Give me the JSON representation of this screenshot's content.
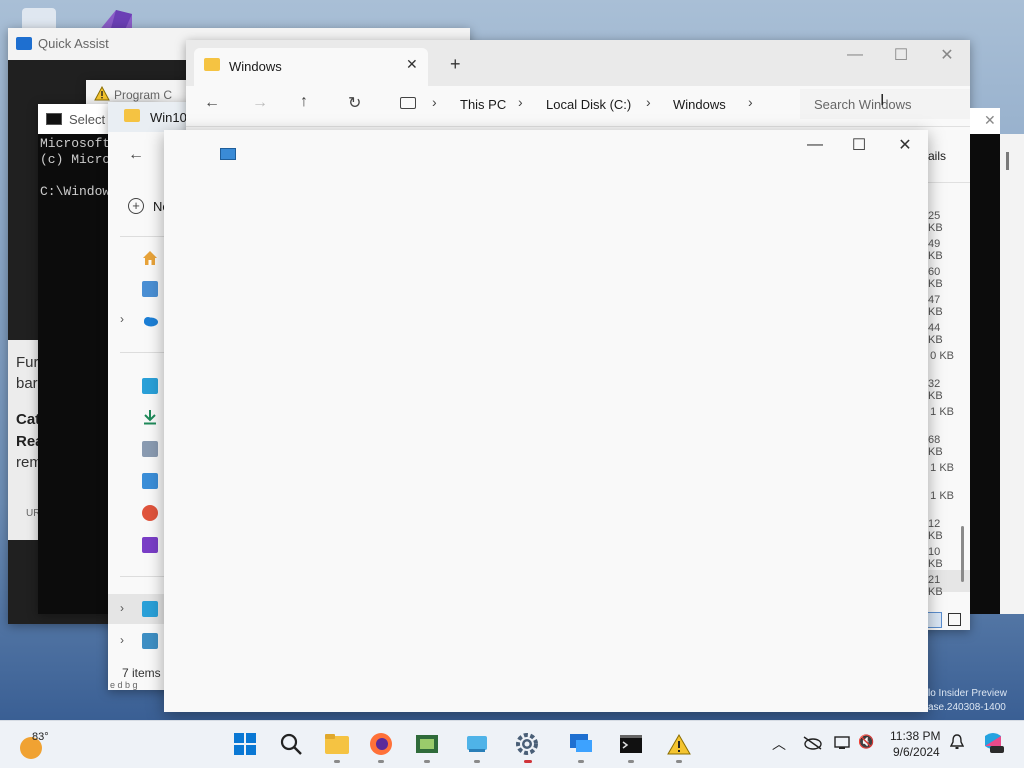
{
  "desktop": {
    "watermark_line1": "lo Insider Preview",
    "watermark_line2": "ase.240308-1400"
  },
  "quick_assist": {
    "title": "Quick Assist",
    "body_line1": "Fur",
    "body_line2": "bar",
    "body_bold1": "Cat",
    "body_bold2": "Rea",
    "body_line3": "rem",
    "footer": "UR"
  },
  "program_window": {
    "title": "Program C"
  },
  "cmd": {
    "title": "Select A",
    "lines": [
      "Microsoft",
      "(c) Micro",
      "",
      "C:\\Window"
    ]
  },
  "explorer_back": {
    "tab_title": "Win10",
    "new_button": "Ne",
    "status": "7 items",
    "status_behind": "e d b g"
  },
  "explorer_main": {
    "tab_title": "Windows",
    "breadcrumb": [
      "This PC",
      "Local Disk (C:)",
      "Windows"
    ],
    "search_placeholder": "Search Windows",
    "details_label": "ails",
    "sizes": [
      "25 KB",
      "49 KB",
      "60 KB",
      "47 KB",
      "44 KB",
      "0 KB",
      "32 KB",
      "1 KB",
      "68 KB",
      "1 KB",
      "1 KB",
      "12 KB",
      "10 KB",
      "21 KB"
    ]
  },
  "taskbar": {
    "weather_temp": "83°",
    "time": "11:38 PM",
    "date": "9/6/2024"
  }
}
